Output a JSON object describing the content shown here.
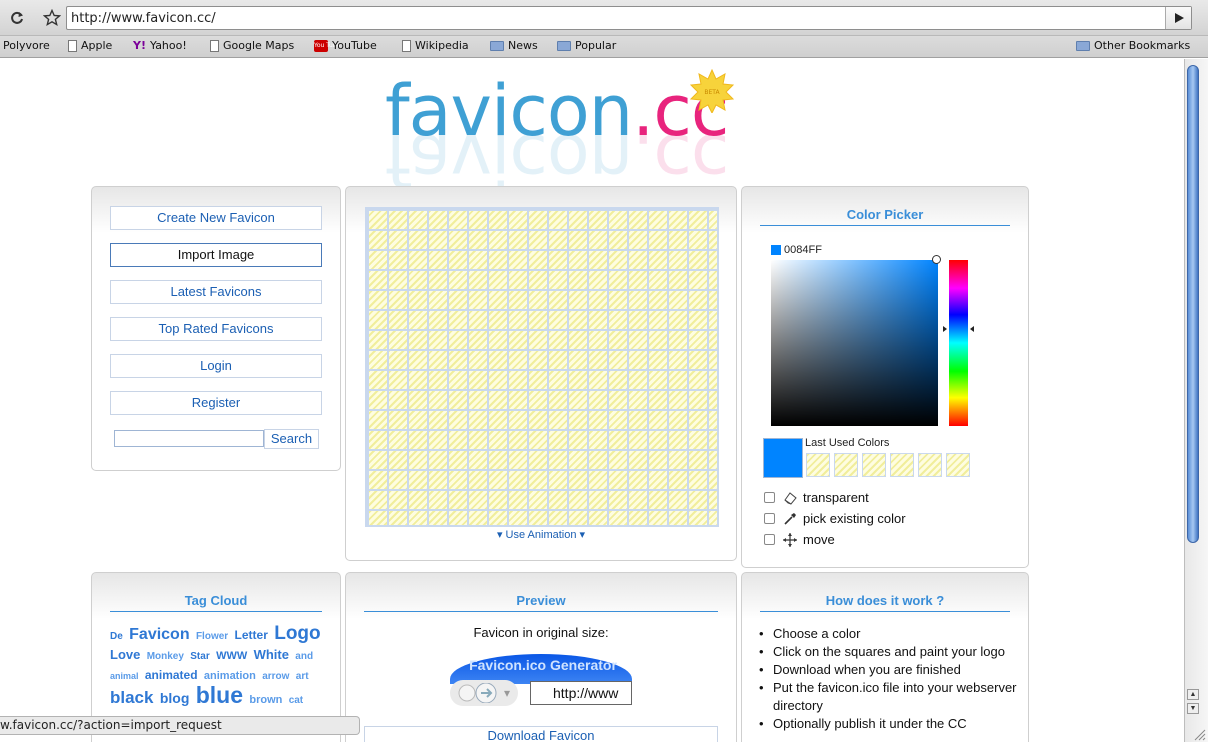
{
  "browser": {
    "url": "http://www.favicon.cc/",
    "status_url": "w.favicon.cc/?action=import_request",
    "bookmarks": [
      {
        "label": "Polyvore",
        "icon": "none"
      },
      {
        "label": "Apple",
        "icon": "page-icon"
      },
      {
        "label": "Yahoo!",
        "icon": "yahoo-icon",
        "icon_text": "Y!"
      },
      {
        "label": "Google Maps",
        "icon": "page-icon"
      },
      {
        "label": "YouTube",
        "icon": "youtube-icon",
        "icon_text": "You Tube"
      },
      {
        "label": "Wikipedia",
        "icon": "page-icon"
      },
      {
        "label": "News",
        "icon": "folder-icon"
      },
      {
        "label": "Popular",
        "icon": "folder-icon"
      }
    ],
    "other_bookmarks": "Other Bookmarks"
  },
  "logo": {
    "part1": "favicon",
    "dot": ".",
    "part2": "cc",
    "badge": "BETA"
  },
  "menu": {
    "items": [
      "Create New Favicon",
      "Import Image",
      "Latest Favicons",
      "Top Rated Favicons",
      "Login",
      "Register"
    ],
    "search_button": "Search",
    "search_value": ""
  },
  "editor": {
    "animation_link": "▾ Use Animation ▾"
  },
  "color_picker": {
    "title": "Color Picker",
    "hex": "0084FF",
    "current_color": "#0084FF",
    "last_used_label": "Last Used Colors",
    "options": [
      "transparent",
      "pick existing color",
      "move"
    ]
  },
  "tag_cloud": {
    "title": "Tag Cloud",
    "tags": [
      {
        "text": "De",
        "size": 10
      },
      {
        "text": "Favicon",
        "size": 16
      },
      {
        "text": "Flower",
        "size": 10
      },
      {
        "text": "Letter",
        "size": 12
      },
      {
        "text": "Logo",
        "size": 19
      },
      {
        "text": "Love",
        "size": 13
      },
      {
        "text": "Monkey",
        "size": 10
      },
      {
        "text": "Star",
        "size": 10
      },
      {
        "text": "WWW",
        "size": 11
      },
      {
        "text": "White",
        "size": 13
      },
      {
        "text": "and",
        "size": 10
      },
      {
        "text": "animal",
        "size": 9
      },
      {
        "text": "animated",
        "size": 12
      },
      {
        "text": "animation",
        "size": 11
      },
      {
        "text": "arrow",
        "size": 10
      },
      {
        "text": "art",
        "size": 10
      },
      {
        "text": "black",
        "size": 17
      },
      {
        "text": "blog",
        "size": 14
      },
      {
        "text": "blue",
        "size": 23
      },
      {
        "text": "brown",
        "size": 11
      },
      {
        "text": "cat",
        "size": 10
      }
    ]
  },
  "preview": {
    "title": "Preview",
    "label": "Favicon in original size:",
    "tab_text": "Favicon.ico Generator",
    "url_text": "http://www",
    "download_label": "Download Favicon"
  },
  "how": {
    "title": "How does it work ?",
    "steps": [
      "Choose a color",
      "Click on the squares and paint your logo",
      "Download when you are finished",
      "Put the favicon.ico file into your webserver directory",
      "Optionally publish it under the CC"
    ]
  }
}
